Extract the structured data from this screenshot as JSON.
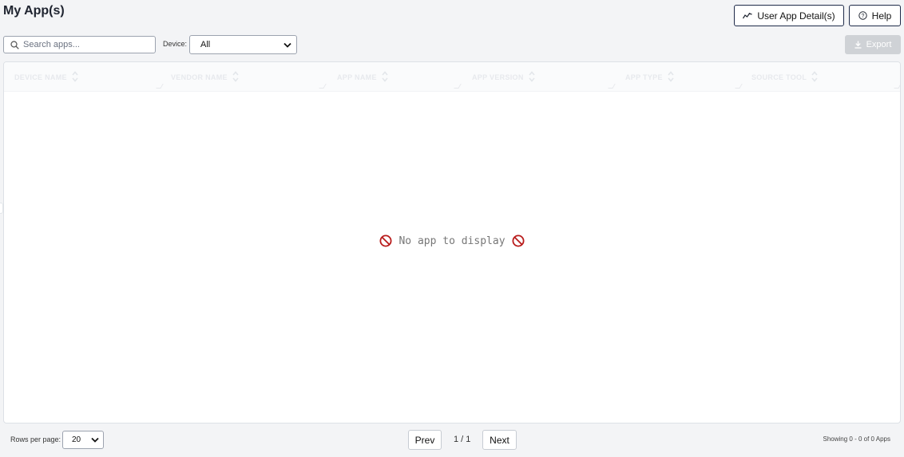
{
  "header": {
    "title": "My App(s)",
    "user_app_detail_label": "User App Detail(s)",
    "help_label": "Help"
  },
  "toolbar": {
    "search_placeholder": "Search apps...",
    "device_label": "Device:",
    "device_selected": "All",
    "export_label": "Export"
  },
  "table": {
    "columns": [
      "DEVICE NAME",
      "VENDOR NAME",
      "APP NAME",
      "APP VERSION",
      "APP TYPE",
      "SOURCE TOOL"
    ],
    "rows": [],
    "empty_message": "No app to display"
  },
  "footer": {
    "rows_per_page_label": "Rows per page:",
    "rows_per_page_value": "20",
    "prev_label": "Prev",
    "page_info": "1 / 1",
    "next_label": "Next",
    "showing_text": "Showing 0 - 0 of 0 Apps"
  },
  "icons": {
    "chart": "trend-chart-icon",
    "help": "help-circle-icon",
    "search": "search-icon",
    "export": "download-icon",
    "sort": "sort-icon",
    "no_entry": "no-entry-icon",
    "chevron": "chevron-down-icon"
  },
  "colors": {
    "accent_border": "#1f2b4a",
    "export_disabled_bg": "#cfd2d6",
    "no_entry_red": "#b91c1c"
  }
}
